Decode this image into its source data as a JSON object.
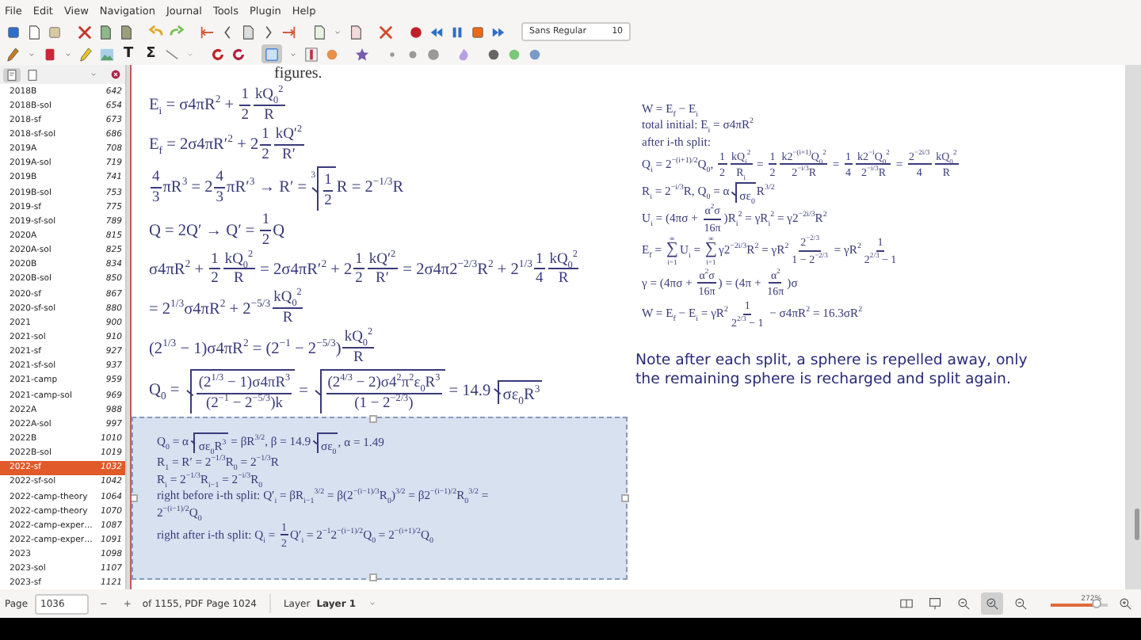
{
  "menu": [
    "File",
    "Edit",
    "View",
    "Navigation",
    "Journal",
    "Tools",
    "Plugin",
    "Help"
  ],
  "toolbar": {
    "font": "Sans Regular",
    "font_size": "10",
    "text_tool": "T",
    "math_tool": "Σ"
  },
  "sidebar": {
    "items": [
      {
        "name": "2018B",
        "page": "642",
        "selected": false
      },
      {
        "name": "2018B-sol",
        "page": "654",
        "selected": false
      },
      {
        "name": "2018-sf",
        "page": "673",
        "selected": false
      },
      {
        "name": "2018-sf-sol",
        "page": "686",
        "selected": false
      },
      {
        "name": "2019A",
        "page": "708",
        "selected": false
      },
      {
        "name": "2019A-sol",
        "page": "719",
        "selected": false
      },
      {
        "name": "2019B",
        "page": "741",
        "selected": false
      },
      {
        "name": "2019B-sol",
        "page": "753",
        "selected": false
      },
      {
        "name": "2019-sf",
        "page": "775",
        "selected": false
      },
      {
        "name": "2019-sf-sol",
        "page": "789",
        "selected": false
      },
      {
        "name": "2020A",
        "page": "815",
        "selected": false
      },
      {
        "name": "2020A-sol",
        "page": "825",
        "selected": false
      },
      {
        "name": "2020B",
        "page": "834",
        "selected": false
      },
      {
        "name": "2020B-sol",
        "page": "850",
        "selected": false
      },
      {
        "name": "2020-sf",
        "page": "867",
        "selected": false
      },
      {
        "name": "2020-sf-sol",
        "page": "880",
        "selected": false
      },
      {
        "name": "2021",
        "page": "900",
        "selected": false
      },
      {
        "name": "2021-sol",
        "page": "910",
        "selected": false
      },
      {
        "name": "2021-sf",
        "page": "927",
        "selected": false
      },
      {
        "name": "2021-sf-sol",
        "page": "937",
        "selected": false
      },
      {
        "name": "2021-camp",
        "page": "959",
        "selected": false
      },
      {
        "name": "2021-camp-sol",
        "page": "969",
        "selected": false
      },
      {
        "name": "2022A",
        "page": "988",
        "selected": false
      },
      {
        "name": "2022A-sol",
        "page": "997",
        "selected": false
      },
      {
        "name": "2022B",
        "page": "1010",
        "selected": false
      },
      {
        "name": "2022B-sol",
        "page": "1019",
        "selected": false
      },
      {
        "name": "2022-sf",
        "page": "1032",
        "selected": true
      },
      {
        "name": "2022-sf-sol",
        "page": "1042",
        "selected": false
      },
      {
        "name": "2022-camp-theory",
        "page": "1064",
        "selected": false
      },
      {
        "name": "2022-camp-theory",
        "page": "1070",
        "selected": false
      },
      {
        "name": "2022-camp-exper…",
        "page": "1087",
        "selected": false
      },
      {
        "name": "2022-camp-exper…",
        "page": "1091",
        "selected": false
      },
      {
        "name": "2023",
        "page": "1098",
        "selected": false
      },
      {
        "name": "2023-sol",
        "page": "1107",
        "selected": false
      },
      {
        "name": "2023-sf",
        "page": "1121",
        "selected": false
      }
    ]
  },
  "page": {
    "heading_fragment": "figures.",
    "left_equations": [
      [
        "E$_{i}$ = σ4πR$^{2}$ + ",
        {
          "frac": [
            [
              "1"
            ],
            [
              "2"
            ]
          ]
        },
        {
          "frac": [
            [
              "kQ$_{0}$$^{2}$"
            ],
            [
              "R"
            ]
          ]
        }
      ],
      [
        "E$_{f}$ = 2σ4πR′$^{2}$ + 2",
        {
          "frac": [
            [
              "1"
            ],
            [
              "2"
            ]
          ]
        },
        {
          "frac": [
            [
              "kQ′$^{2}$"
            ],
            [
              "R′"
            ]
          ]
        }
      ],
      [
        {
          "frac": [
            [
              "4"
            ],
            [
              "3"
            ]
          ]
        },
        "πR$^{3}$ = 2",
        {
          "frac": [
            [
              "4"
            ],
            [
              "3"
            ]
          ]
        },
        "πR′$^{3}$ → R′ = ",
        {
          "sqrt": [
            {
              "frac": [
                [
                  "1"
                ],
                [
                  "2"
                ]
              ]
            }
          ],
          "index": "3"
        },
        "R = 2$^{−1/3}$R"
      ],
      [
        "Q = 2Q′ → Q′ = ",
        {
          "frac": [
            [
              "1"
            ],
            [
              "2"
            ]
          ]
        },
        "Q"
      ],
      [
        "σ4πR$^{2}$ + ",
        {
          "frac": [
            [
              "1"
            ],
            [
              "2"
            ]
          ]
        },
        {
          "frac": [
            [
              "kQ$_{0}$$^{2}$"
            ],
            [
              "R"
            ]
          ]
        },
        " = 2σ4πR′$^{2}$ + 2",
        {
          "frac": [
            [
              "1"
            ],
            [
              "2"
            ]
          ]
        },
        {
          "frac": [
            [
              "kQ′$^{2}$"
            ],
            [
              "R′"
            ]
          ]
        },
        " = 2σ4π2$^{−2/3}$R$^{2}$ + 2$^{1/3}$",
        {
          "frac": [
            [
              "1"
            ],
            [
              "4"
            ]
          ]
        },
        {
          "frac": [
            [
              "kQ$_{0}$$^{2}$"
            ],
            [
              "R"
            ]
          ]
        }
      ],
      [
        "= 2$^{1/3}$σ4πR$^{2}$ + 2$^{−5/3}$",
        {
          "frac": [
            [
              "kQ$_{0}$$^{2}$"
            ],
            [
              "R"
            ]
          ]
        }
      ],
      [
        "(2$^{1/3}$ − 1)σ4πR$^{2}$ = (2$^{−1}$ − 2$^{−5/3}$)",
        {
          "frac": [
            [
              "kQ$_{0}$$^{2}$"
            ],
            [
              "R"
            ]
          ]
        }
      ],
      [
        "Q$_{0}$ = ",
        {
          "sqrt": [
            {
              "frac": [
                [
                  "(2$^{1/3}$ − 1)σ4πR$^{3}$"
                ],
                [
                  "(2$^{−1}$ − 2$^{−5/3}$)k"
                ]
              ]
            }
          ]
        },
        " = ",
        {
          "sqrt": [
            {
              "frac": [
                [
                  "(2$^{4/3}$ − 2)σ4$^{2}$π$^{2}$ε$_{0}$R$^{3}$"
                ],
                [
                  "(1 − 2$^{−2/3}$)"
                ]
              ]
            }
          ]
        },
        " = 14.9",
        {
          "sqrt": [
            "σε$_{0}$R$^{3}$"
          ]
        }
      ]
    ],
    "box_equations": [
      [
        "Q$_{0}$ = α",
        {
          "sqrt": [
            "σε$_{0}$R$^{3}$"
          ]
        },
        " = βR$^{3/2}$, β = 14.9",
        {
          "sqrt": [
            "σε$_{0}$"
          ]
        },
        ", α = 1.49"
      ],
      [
        "R$_{1}$ = R′ = 2$^{−1/3}$R$_{0}$ = 2$^{−1/3}$R"
      ],
      [
        "R$_{i}$ = 2$^{−1/3}$R$_{i−1}$ = 2$^{−i/3}$R$_{0}$"
      ],
      [
        "right before i-th split: Q′$_{i}$ = βR$_{i−1}$$^{3/2}$ = β(2$^{−(i−1)/3}$R$_{0}$)$^{3/2}$ = β2$^{−(i−1)/2}$R$_{0}$$^{3/2}$ ="
      ],
      [
        "2$^{−(i−1)/2}$Q$_{0}$"
      ],
      [
        "right after i-th split: Q$_{i}$ = ",
        {
          "frac": [
            [
              "1"
            ],
            [
              "2"
            ]
          ]
        },
        "Q′$_{i}$ = 2$^{−1}$2$^{−(i−1)/2}$Q$_{0}$ = 2$^{−(i+1)/2}$Q$_{0}$"
      ]
    ],
    "right_equations": [
      [
        "W = E$_{f}$ − E$_{i}$"
      ],
      [
        "total initial: E$_{i}$ = σ4πR$^{2}$"
      ],
      [
        "after i-th split:"
      ],
      [
        "Q$_{i}$ = 2$^{−(i+1)/2}$Q$_{0}$, ",
        {
          "frac": [
            [
              "1"
            ],
            [
              "2"
            ]
          ]
        },
        {
          "frac": [
            [
              "kQ$_{i}$$^{2}$"
            ],
            [
              "R$_{i}$"
            ]
          ]
        },
        " = ",
        {
          "frac": [
            [
              "1"
            ],
            [
              "2"
            ]
          ]
        },
        {
          "frac": [
            [
              "k2$^{−(i+1)}$Q$_{0}$$^{2}$"
            ],
            [
              "2$^{−i/3}$R"
            ]
          ]
        },
        " = ",
        {
          "frac": [
            [
              "1"
            ],
            [
              "4"
            ]
          ]
        },
        {
          "frac": [
            [
              "k2$^{−i}$Q$_{0}$$^{2}$"
            ],
            [
              "2$^{−i/3}$R"
            ]
          ]
        },
        " = ",
        {
          "frac": [
            [
              "2$^{−2i/3}$"
            ],
            [
              "4"
            ]
          ]
        },
        {
          "frac": [
            [
              "kQ$_{0}$$^{2}$"
            ],
            [
              "R"
            ]
          ]
        }
      ],
      [
        "R$_{i}$ = 2$^{−i/3}$R, Q$_{0}$ = α",
        {
          "sqrt": [
            "σε$_{0}$"
          ]
        },
        "R$^{3/2}$"
      ],
      [
        "U$_{i}$ = (4πσ + ",
        {
          "frac": [
            [
              "α$^{2}$σ"
            ],
            [
              "16π"
            ]
          ]
        },
        ")R$_{i}$$^{2}$ = γR$_{i}$$^{2}$ = γ2$^{−2i/3}$R$^{2}$"
      ],
      [
        "E$_{f}$ = ",
        {
          "sum": "∑",
          "top": "∞",
          "bottom": "i=1"
        },
        "U$_{i}$ = ",
        {
          "sum": "∑",
          "top": "∞",
          "bottom": "i=1"
        },
        "γ2$^{−2i/3}$R$^{2}$ = γR$^{2}$",
        {
          "frac": [
            [
              "2$^{−2/3}$"
            ],
            [
              "1 − 2$^{−2/3}$"
            ]
          ]
        },
        " = γR$^{2}$",
        {
          "frac": [
            [
              "1"
            ],
            [
              "2$^{2/3}$ − 1"
            ]
          ]
        }
      ],
      [
        "γ = (4πσ + ",
        {
          "frac": [
            [
              "α$^{2}$σ"
            ],
            [
              "16π"
            ]
          ]
        },
        ") = (4π + ",
        {
          "frac": [
            [
              "α$^{2}$"
            ],
            [
              "16π"
            ]
          ]
        },
        ")σ"
      ],
      [
        "W = E$_{f}$ − E$_{i}$ = γR$^{2}$",
        {
          "frac": [
            [
              "1"
            ],
            [
              "2$^{2/3}$ − 1"
            ]
          ]
        },
        " − σ4πR$^{2}$ = 16.3σR$^{2}$"
      ]
    ],
    "note": "Note after each split, a sphere is repelled away, only the remaining sphere is recharged and split again."
  },
  "status_bar": {
    "page_label": "Page",
    "page": "1036",
    "minus": "−",
    "plus": "+",
    "page_info": "of 1155, PDF Page 1024",
    "layer_label": "Layer",
    "layer": "Layer 1",
    "zoom": "272%",
    "zoom_level": {
      "level": 0.8
    }
  }
}
